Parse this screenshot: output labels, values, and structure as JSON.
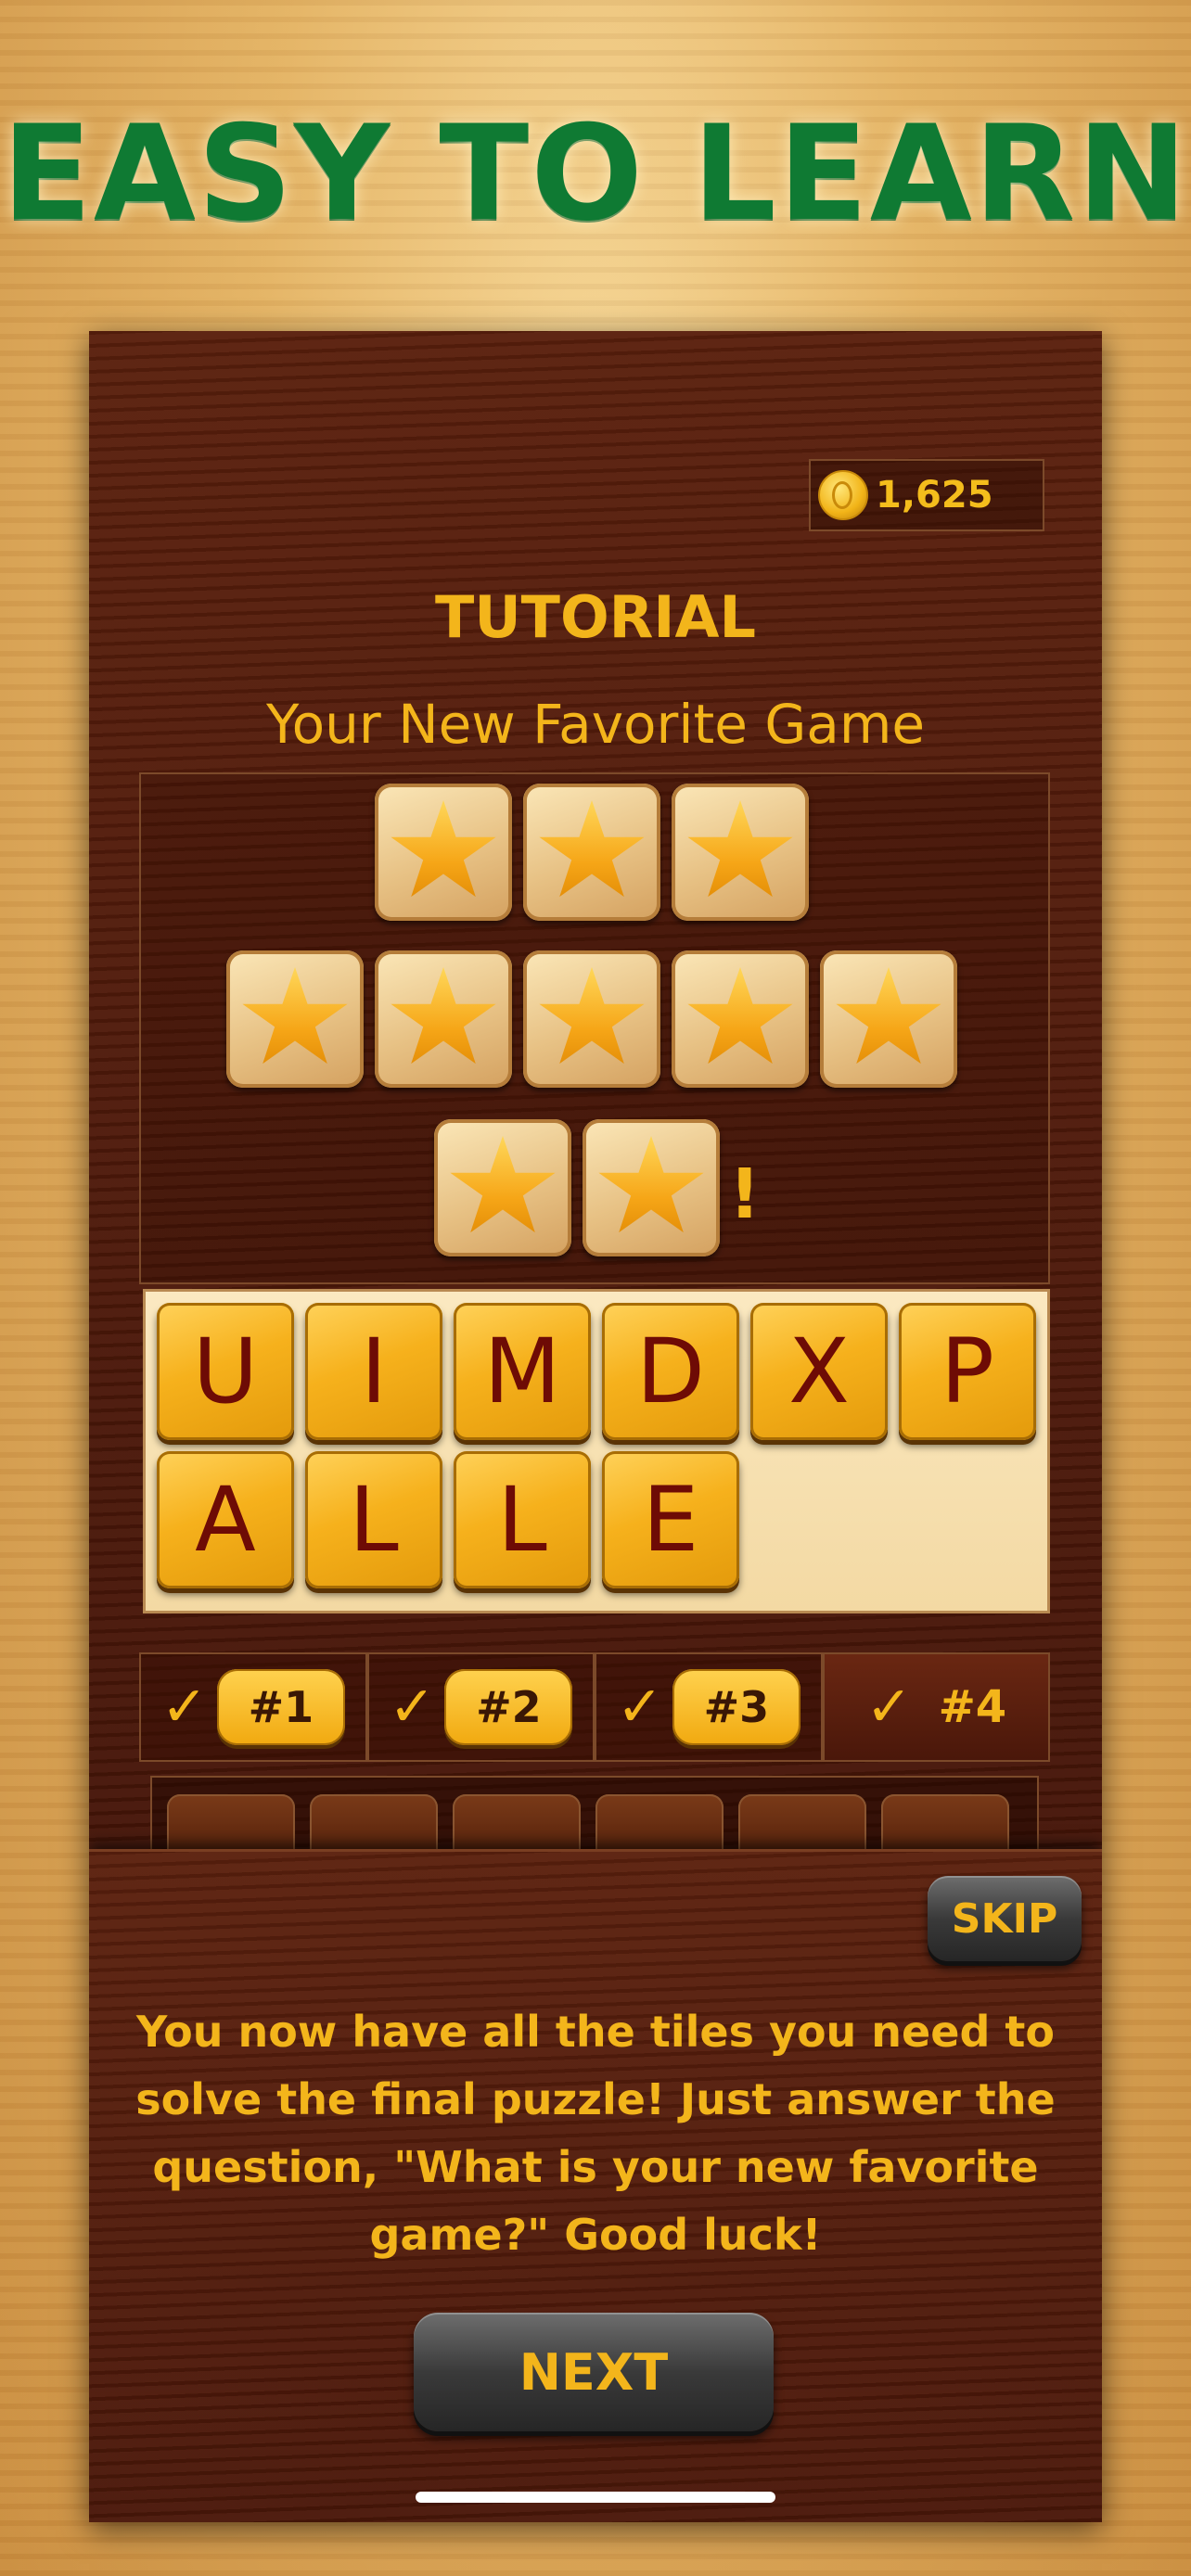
{
  "headline": "EASY TO LEARN",
  "coins": {
    "count": "1,625"
  },
  "screen": {
    "title": "TUTORIAL",
    "subtitle": "Your New Favorite Game",
    "exclamation": "!"
  },
  "tray_letters": [
    "U",
    "I",
    "M",
    "D",
    "X",
    "P",
    "A",
    "L",
    "L",
    "E"
  ],
  "tabs": [
    {
      "check": "✓",
      "label": "#1",
      "style": "pill"
    },
    {
      "check": "✓",
      "label": "#2",
      "style": "pill"
    },
    {
      "check": "✓",
      "label": "#3",
      "style": "pill"
    },
    {
      "check": "✓",
      "label": "#4",
      "style": "plain"
    }
  ],
  "overlay": {
    "skip_label": "SKIP",
    "message": "You now have all the tiles you need to solve the final puzzle! Just answer the question, \"What is your new favorite game?\"  Good luck!",
    "next_label": "NEXT"
  },
  "colors": {
    "headline": "#0f7a33",
    "gold_text": "#f3b51b",
    "tile_letter": "#6e0b05",
    "wood_dark": "#4a1709"
  }
}
